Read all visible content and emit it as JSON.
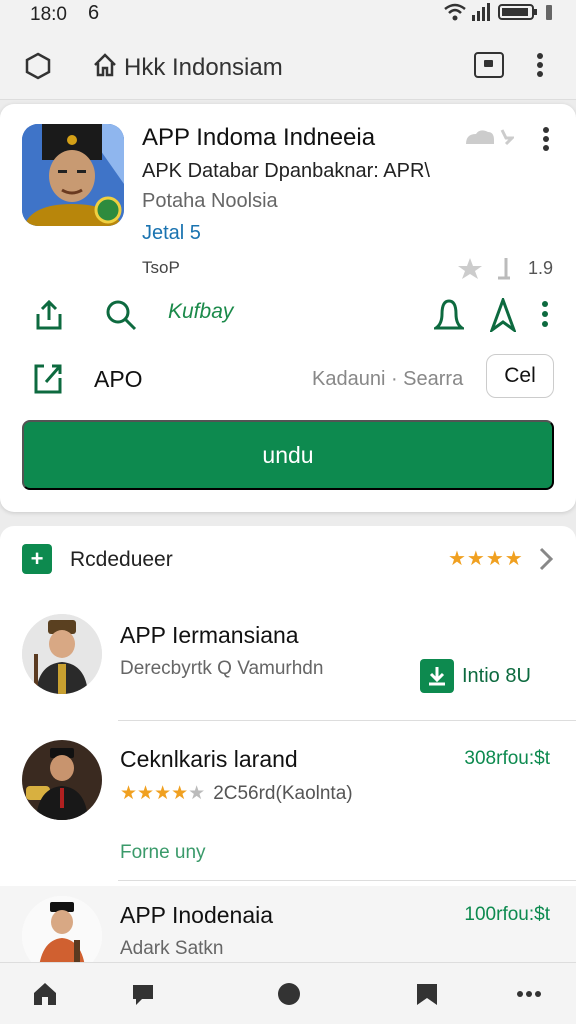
{
  "status_bar": {
    "time": "18:0",
    "moon": "6"
  },
  "browser": {
    "url": "Hkk Indonsiam"
  },
  "app": {
    "title": "APP Indoma Indneeia",
    "subtitle": "APK Databar Dpanbaknar: APR\\",
    "publisher": "Potaha Noolsia",
    "detail_link": "Jetal 5",
    "top_label": "TsoP",
    "rating_value": "1.9",
    "kufbay_label": "Kufbay",
    "apo_label": "APO",
    "apo_meta": "Kadauni · Searra",
    "cel_button": "Cel",
    "install_button": "undu"
  },
  "section": {
    "title": "Rcdedueer",
    "stars": "★★★★"
  },
  "items": [
    {
      "title": "APP Iermansiana",
      "sub": "Derecbyrtk Q Vamurhdn",
      "chip": "Intio 8U"
    },
    {
      "title": "Ceknlkaris larand",
      "price": "308rfou:$t",
      "stars_filled": "★★★★",
      "stars_empty": "★",
      "rating_count": "2C56rd(Kaolnta)",
      "link": "Forne uny"
    },
    {
      "title": "APP Inodenaia",
      "price": "100rfou:$t",
      "sub": "Adark Satkn"
    }
  ],
  "colors": {
    "accent": "#0d8a4f",
    "link": "#1a73b0",
    "star": "#f0a020"
  }
}
